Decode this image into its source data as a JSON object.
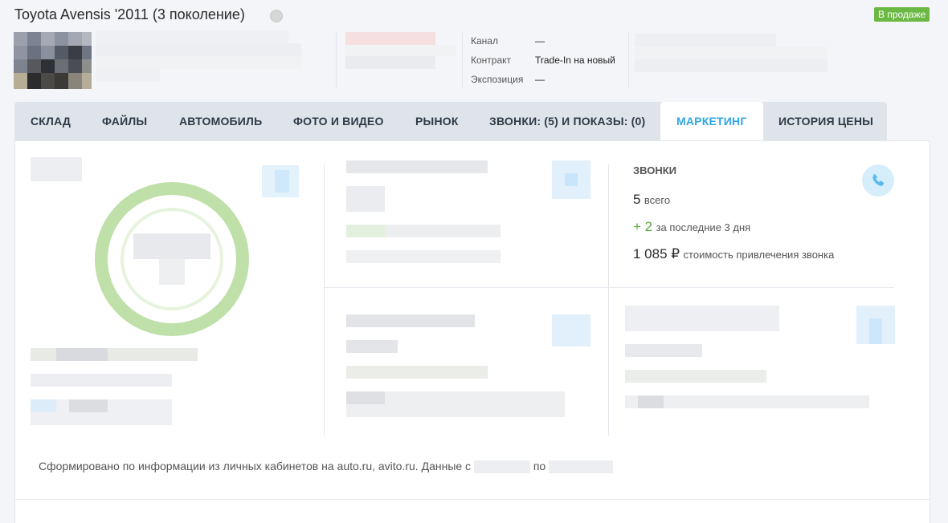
{
  "header": {
    "title": "Toyota Avensis '2011 (3 поколение)",
    "status_badge": "В продаже",
    "meta": [
      {
        "label": "Канал",
        "value": "—"
      },
      {
        "label": "Контракт",
        "value": "Trade-In на новый"
      },
      {
        "label": "Экспозиция",
        "value": "—"
      }
    ]
  },
  "tabs": [
    {
      "label": "СКЛАД"
    },
    {
      "label": "ФАЙЛЫ"
    },
    {
      "label": "АВТОМОБИЛЬ"
    },
    {
      "label": "ФОТО И ВИДЕО"
    },
    {
      "label": "РЫНОК"
    },
    {
      "label": "ЗВОНКИ: (5) И ПОКАЗЫ: (0)"
    },
    {
      "label": "МАРКЕТИНГ",
      "active": true
    },
    {
      "label": "ИСТОРИЯ ЦЕНЫ"
    }
  ],
  "calls": {
    "title": "ЗВОНКИ",
    "total_value": "5",
    "total_label": "всего",
    "recent_value": "+ 2",
    "recent_label": "за последние 3 дня",
    "cost_value": "1 085 ₽",
    "cost_label": "стоимость привлечения звонка"
  },
  "footer": {
    "note": "Сформировано по информации из личных кабинетов на auto.ru, avito.ru. Данные с",
    "between": "по"
  },
  "colors": {
    "accent": "#2ea6e6",
    "badge_green": "#6cb845",
    "recent_green": "#5aa83a"
  },
  "icons": {
    "status": "status-dot-icon",
    "phone": "phone-icon"
  }
}
